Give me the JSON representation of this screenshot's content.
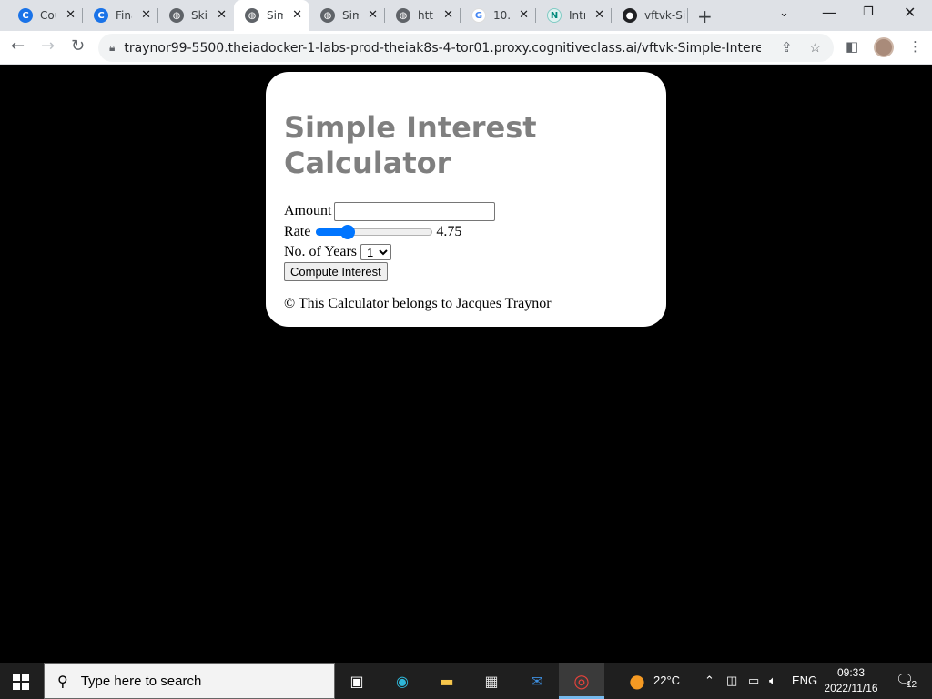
{
  "browser": {
    "tabs": [
      {
        "title": "Cou",
        "icon": "c-logo-icon"
      },
      {
        "title": "Fina",
        "icon": "c-logo-icon"
      },
      {
        "title": "Skil",
        "icon": "globe-icon"
      },
      {
        "title": "Sim",
        "icon": "globe-icon",
        "active": true
      },
      {
        "title": "Sim",
        "icon": "globe-icon"
      },
      {
        "title": "http",
        "icon": "globe-icon"
      },
      {
        "title": "10.",
        "icon": "google-icon"
      },
      {
        "title": "Intr",
        "icon": "n-logo-icon"
      },
      {
        "title": "vftvk-Si",
        "icon": "github-icon"
      }
    ],
    "url": "traynor99-5500.theiadocker-1-labs-prod-theiak8s-4-tor01.proxy.cognitiveclass.ai/vftvk-Simple-Interest-Calculato..."
  },
  "page": {
    "title": "Simple Interest Calculator",
    "amount_label": "Amount",
    "amount_value": "",
    "rate_label": "Rate",
    "rate_value": "4.75",
    "rate_fraction": 0.24,
    "years_label": "No. of Years",
    "years_selected": "1",
    "compute_label": "Compute Interest",
    "copyright": "© This Calculator belongs to Jacques Traynor"
  },
  "taskbar": {
    "search_placeholder": "Type here to search",
    "temperature": "22°C",
    "language": "ENG",
    "time": "09:33",
    "date": "2022/11/16",
    "notifications": "12"
  },
  "colors": {
    "accent": "#0075ff",
    "title_gray": "#7f7f7f"
  }
}
